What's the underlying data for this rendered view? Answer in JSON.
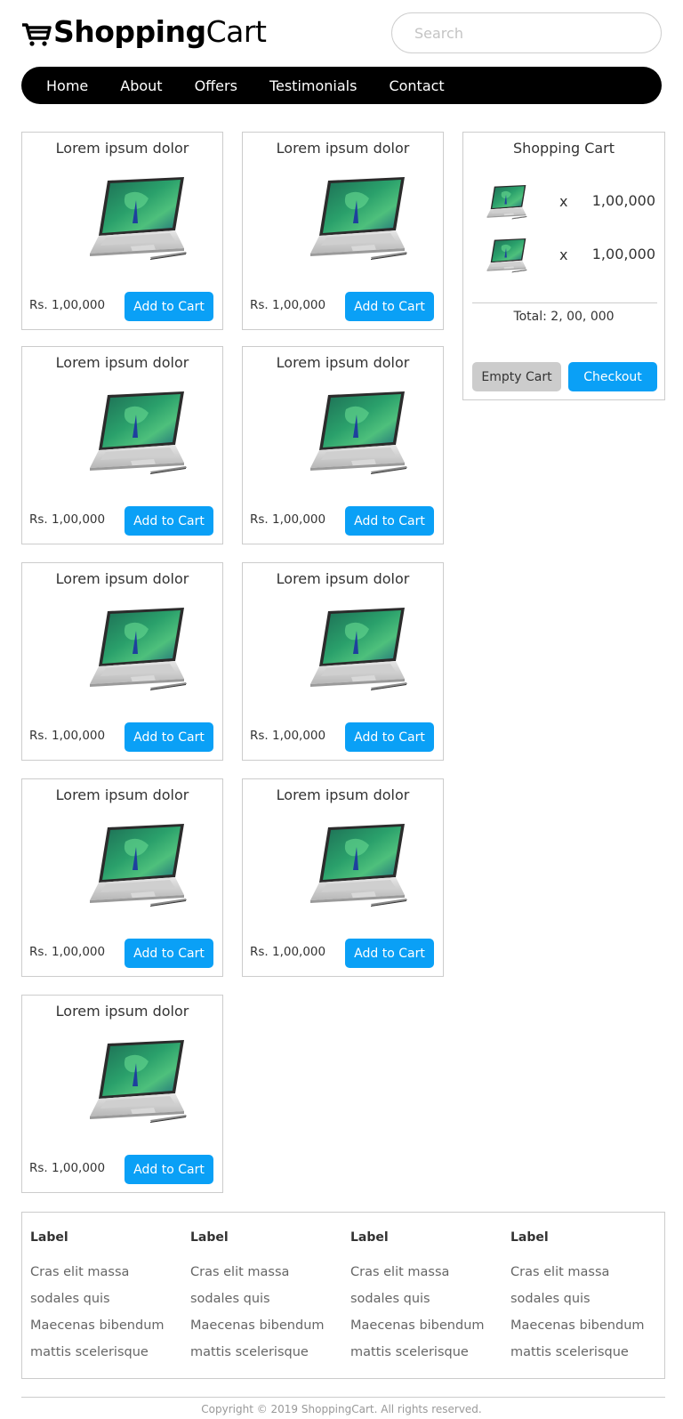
{
  "header": {
    "brand_bold": "Shopping",
    "brand_light": "Cart",
    "search_placeholder": "Search"
  },
  "nav": {
    "items": [
      "Home",
      "About",
      "Offers",
      "Testimonials",
      "Contact"
    ]
  },
  "products": [
    {
      "title": "Lorem ipsum dolor",
      "price": "Rs. 1,00,000",
      "button": "Add to Cart"
    },
    {
      "title": "Lorem ipsum dolor",
      "price": "Rs. 1,00,000",
      "button": "Add to Cart"
    },
    {
      "title": "Lorem ipsum dolor",
      "price": "Rs. 1,00,000",
      "button": "Add to Cart"
    },
    {
      "title": "Lorem ipsum dolor",
      "price": "Rs. 1,00,000",
      "button": "Add to Cart"
    },
    {
      "title": "Lorem ipsum dolor",
      "price": "Rs. 1,00,000",
      "button": "Add to Cart"
    },
    {
      "title": "Lorem ipsum dolor",
      "price": "Rs. 1,00,000",
      "button": "Add to Cart"
    },
    {
      "title": "Lorem ipsum dolor",
      "price": "Rs. 1,00,000",
      "button": "Add to Cart"
    },
    {
      "title": "Lorem ipsum dolor",
      "price": "Rs. 1,00,000",
      "button": "Add to Cart"
    },
    {
      "title": "Lorem ipsum dolor",
      "price": "Rs. 1,00,000",
      "button": "Add to Cart"
    }
  ],
  "cart": {
    "title": "Shopping Cart",
    "items": [
      {
        "qty_symbol": "x",
        "price": "1,00,000"
      },
      {
        "qty_symbol": "x",
        "price": "1,00,000"
      }
    ],
    "total": "Total: 2, 00, 000",
    "empty_label": "Empty Cart",
    "checkout_label": "Checkout"
  },
  "footer": {
    "columns": [
      {
        "label": "Label",
        "links": [
          "Cras elit massa",
          "sodales quis",
          "Maecenas bibendum",
          "mattis scelerisque"
        ]
      },
      {
        "label": "Label",
        "links": [
          "Cras elit massa",
          "sodales quis",
          "Maecenas bibendum",
          "mattis scelerisque"
        ]
      },
      {
        "label": "Label",
        "links": [
          "Cras elit massa",
          "sodales quis",
          "Maecenas bibendum",
          "mattis scelerisque"
        ]
      },
      {
        "label": "Label",
        "links": [
          "Cras elit massa",
          "sodales quis",
          "Maecenas bibendum",
          "mattis scelerisque"
        ]
      }
    ],
    "copyright": "Copyright © 2019 ShoppingCart. All rights reserved."
  },
  "colors": {
    "accent": "#0aa0f6",
    "nav_bg": "#000000",
    "border": "#cccccc",
    "empty_button": "#cccccc"
  },
  "icons": {
    "brand": "shopping-cart-icon",
    "product_image": "laptop-image"
  }
}
